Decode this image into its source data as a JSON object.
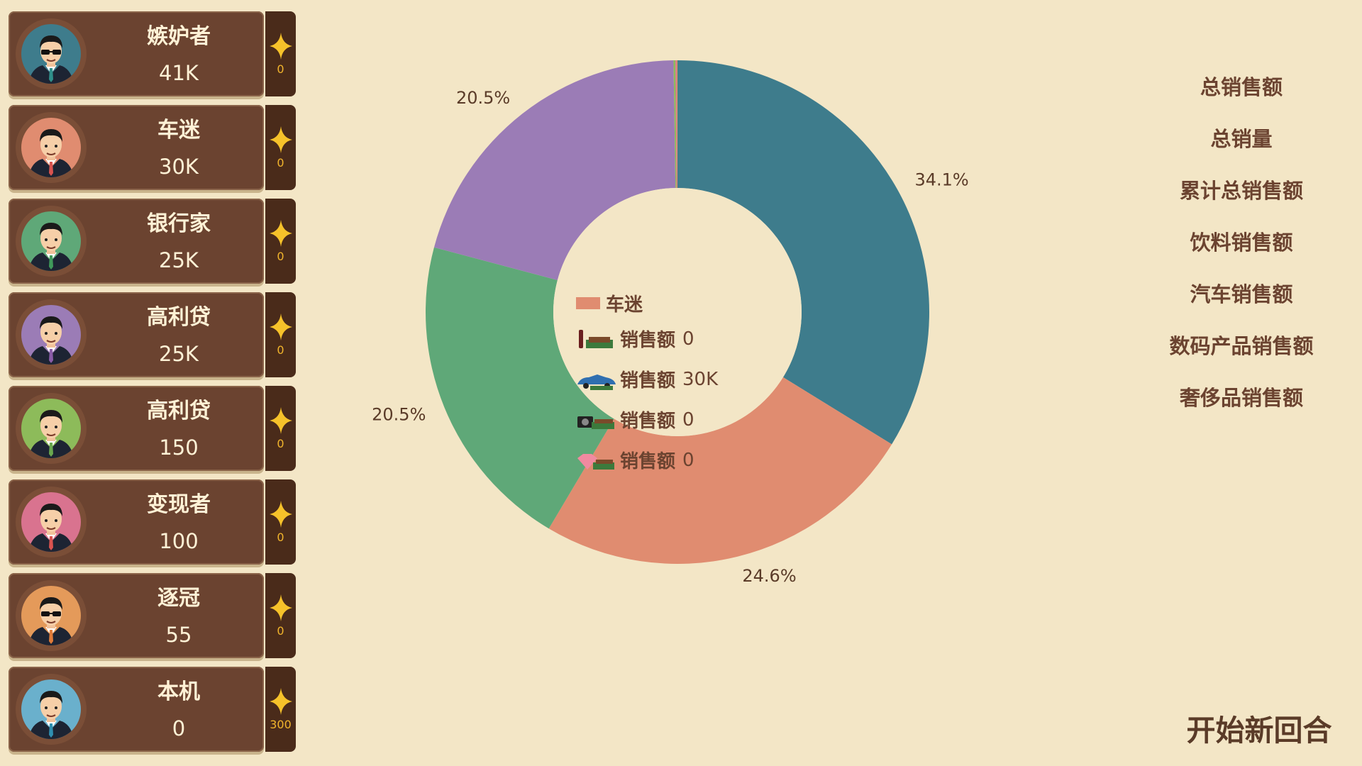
{
  "players": [
    {
      "name": "嫉妒者",
      "score": "41K",
      "stars": "0",
      "bg": "#3e7c8c",
      "tie": "#2f8f8a",
      "glasses": true
    },
    {
      "name": "车迷",
      "score": "30K",
      "stars": "0",
      "bg": "#e08c70",
      "tie": "#d9534f",
      "glasses": false
    },
    {
      "name": "银行家",
      "score": "25K",
      "stars": "0",
      "bg": "#5fa878",
      "tie": "#3f9a5a",
      "glasses": false
    },
    {
      "name": "高利贷",
      "score": "25K",
      "stars": "0",
      "bg": "#9b7cb6",
      "tie": "#8a5ca8",
      "glasses": false
    },
    {
      "name": "高利贷",
      "score": "150",
      "stars": "0",
      "bg": "#8dbb5a",
      "tie": "#6aa84f",
      "glasses": false
    },
    {
      "name": "变现者",
      "score": "100",
      "stars": "0",
      "bg": "#d9738f",
      "tie": "#d9534f",
      "glasses": false
    },
    {
      "name": "逐冠",
      "score": "55",
      "stars": "0",
      "bg": "#e49a5a",
      "tie": "#e07b39",
      "glasses": true
    },
    {
      "name": "本机",
      "score": "0",
      "stars": "300",
      "bg": "#6ab0cc",
      "tie": "#2f8fb0",
      "glasses": false
    }
  ],
  "chart_data": {
    "type": "pie",
    "donut": true,
    "slices": [
      {
        "label": "嫉妒者",
        "value": 41,
        "percent_label": "34.1%",
        "color": "#3e7c8c"
      },
      {
        "label": "车迷",
        "value": 30,
        "percent_label": "24.6%",
        "color": "#e08c70"
      },
      {
        "label": "银行家",
        "value": 25,
        "percent_label": "20.5%",
        "color": "#5fa878"
      },
      {
        "label": "高利贷",
        "value": 25,
        "percent_label": "20.5%",
        "color": "#9b7cb6"
      },
      {
        "label": "高利贷",
        "value": 0.15,
        "percent_label": "",
        "color": "#8dbb5a"
      },
      {
        "label": "变现者",
        "value": 0.1,
        "percent_label": "",
        "color": "#d9738f"
      },
      {
        "label": "逐冠",
        "value": 0.055,
        "percent_label": "",
        "color": "#e49a5a"
      },
      {
        "label": "本机",
        "value": 0,
        "percent_label": "",
        "color": "#6ab0cc"
      }
    ],
    "legend": {
      "title": "车迷",
      "swatch_color": "#e08c70",
      "rows": [
        {
          "icon": "drink-icon",
          "label": "销售额",
          "value": "0"
        },
        {
          "icon": "car-icon",
          "label": "销售额",
          "value": "30K"
        },
        {
          "icon": "camera-icon",
          "label": "销售额",
          "value": "0"
        },
        {
          "icon": "diamond-icon",
          "label": "销售额",
          "value": "0"
        }
      ]
    }
  },
  "menu": {
    "items": [
      "总销售额",
      "总销量",
      "累计总销售额",
      "饮料销售额",
      "汽车销售额",
      "数码产品销售额",
      "奢侈品销售额"
    ],
    "new_round": "开始新回合"
  }
}
